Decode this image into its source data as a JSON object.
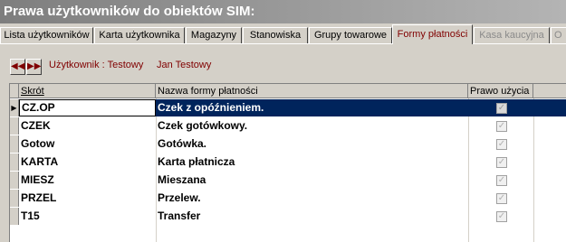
{
  "window": {
    "title": "Prawa użytkowników do obiektów SIM:"
  },
  "tabs": [
    {
      "label": "Lista użytkowników",
      "state": "normal"
    },
    {
      "label": "Karta użytkownika",
      "state": "normal"
    },
    {
      "label": "Magazyny",
      "state": "normal"
    },
    {
      "label": "Stanowiska",
      "state": "normal"
    },
    {
      "label": "Grupy towarowe",
      "state": "normal"
    },
    {
      "label": "Formy płatności",
      "state": "active"
    },
    {
      "label": "Kasa kaucyjna",
      "state": "disabled"
    },
    {
      "label": "O",
      "state": "disabled"
    }
  ],
  "nav": {
    "prev_icon": "double-chevron-left-icon",
    "next_icon": "double-chevron-right-icon",
    "user_label": "Użytkownik : Testowy",
    "user_name": "Jan Testowy"
  },
  "grid": {
    "columns": [
      "Skrót",
      "Nazwa formy płatności",
      "Prawo użycia"
    ],
    "rows": [
      {
        "code": "CZ.OP",
        "name": "Czek z opóźnieniem.",
        "allowed": true,
        "selected": true
      },
      {
        "code": "CZEK",
        "name": "Czek gotówkowy.",
        "allowed": true,
        "selected": false
      },
      {
        "code": "Gotow",
        "name": "Gotówka.",
        "allowed": true,
        "selected": false
      },
      {
        "code": "KARTA",
        "name": "Karta płatnicza",
        "allowed": true,
        "selected": false
      },
      {
        "code": "MIESZ",
        "name": "Mieszana",
        "allowed": true,
        "selected": false
      },
      {
        "code": "PRZEL",
        "name": "Przelew.",
        "allowed": true,
        "selected": false
      },
      {
        "code": "T15",
        "name": "Transfer",
        "allowed": true,
        "selected": false
      }
    ],
    "row_indicator": "▶",
    "check_glyph": "✓"
  },
  "colors": {
    "selection": "#00245c",
    "accent_text": "#800000",
    "face": "#d4d0c8"
  }
}
